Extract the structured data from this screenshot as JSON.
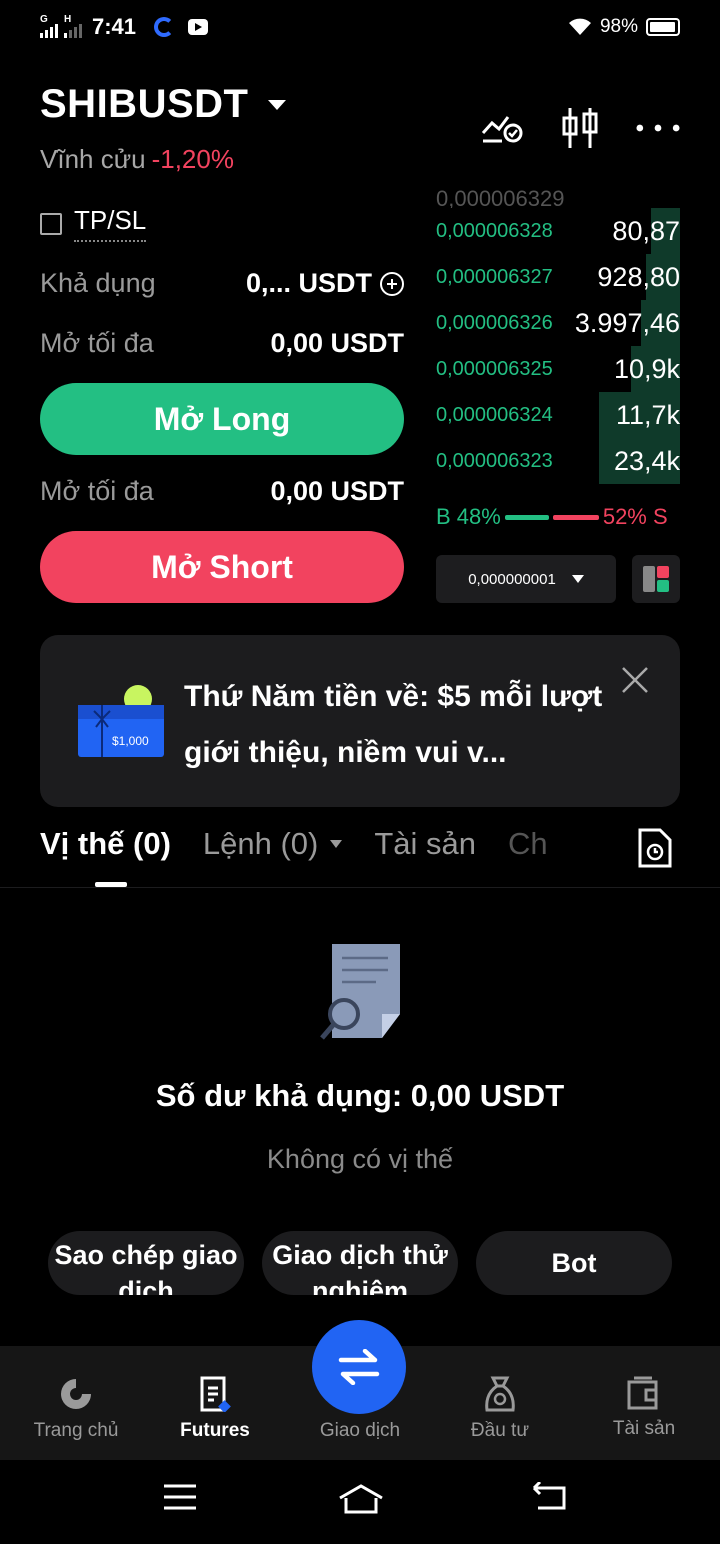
{
  "status_bar": {
    "time": "7:41",
    "battery": "98%",
    "signal_1_label": "G",
    "signal_2_label": "H"
  },
  "header": {
    "pair": "SHIBUSDT",
    "type": "Vĩnh cửu",
    "change": "-1,20%",
    "icons": [
      "chart-alert-icon",
      "candlestick-icon",
      "more-icon"
    ]
  },
  "trade": {
    "tpsl_label": "TP/SL",
    "available_label": "Khả dụng",
    "available_value": "0,... USDT",
    "max_open_label_1": "Mở tối đa",
    "max_open_value_1": "0,00 USDT",
    "long_button": "Mở Long",
    "max_open_label_2": "Mở tối đa",
    "max_open_value_2": "0,00 USDT",
    "short_button": "Mở Short"
  },
  "order_book": {
    "cut_row_price": "0,000006329",
    "rows": [
      {
        "price": "0,000006328",
        "qty": "80,87",
        "depth": 0.12
      },
      {
        "price": "0,000006327",
        "qty": "928,80",
        "depth": 0.14
      },
      {
        "price": "0,000006326",
        "qty": "3.997,46",
        "depth": 0.16
      },
      {
        "price": "0,000006325",
        "qty": "10,9k",
        "depth": 0.2
      },
      {
        "price": "0,000006324",
        "qty": "11,7k",
        "depth": 0.33
      },
      {
        "price": "0,000006323",
        "qty": "23,4k",
        "depth": 0.33
      }
    ],
    "buy_label": "B 48%",
    "sell_label": "52% S",
    "buy_pct": 48,
    "sell_pct": 52,
    "tick_size": "0,000000001"
  },
  "promo": {
    "text": "Thứ Năm tiền về: $5 mỗi lượt giới thiệu, niềm vui v...",
    "gift_amount": "$1,000"
  },
  "tabs": {
    "positions": "Vị thế (0)",
    "orders": "Lệnh (0)",
    "assets": "Tài sản",
    "partial": "Ch"
  },
  "empty": {
    "balance": "Số dư khả dụng: 0,00 USDT",
    "no_positions": "Không có vị thế"
  },
  "chips": {
    "copy_trade": "Sao chép giao dịch",
    "demo_trade": "Giao dịch thử nghiệm",
    "bot": "Bot"
  },
  "nav": {
    "home": "Trang chủ",
    "futures": "Futures",
    "trade": "Giao dịch",
    "invest": "Đầu tư",
    "assets": "Tài sản"
  },
  "colors": {
    "green": "#23bf83",
    "red": "#f2435f",
    "blue": "#2164f3"
  }
}
